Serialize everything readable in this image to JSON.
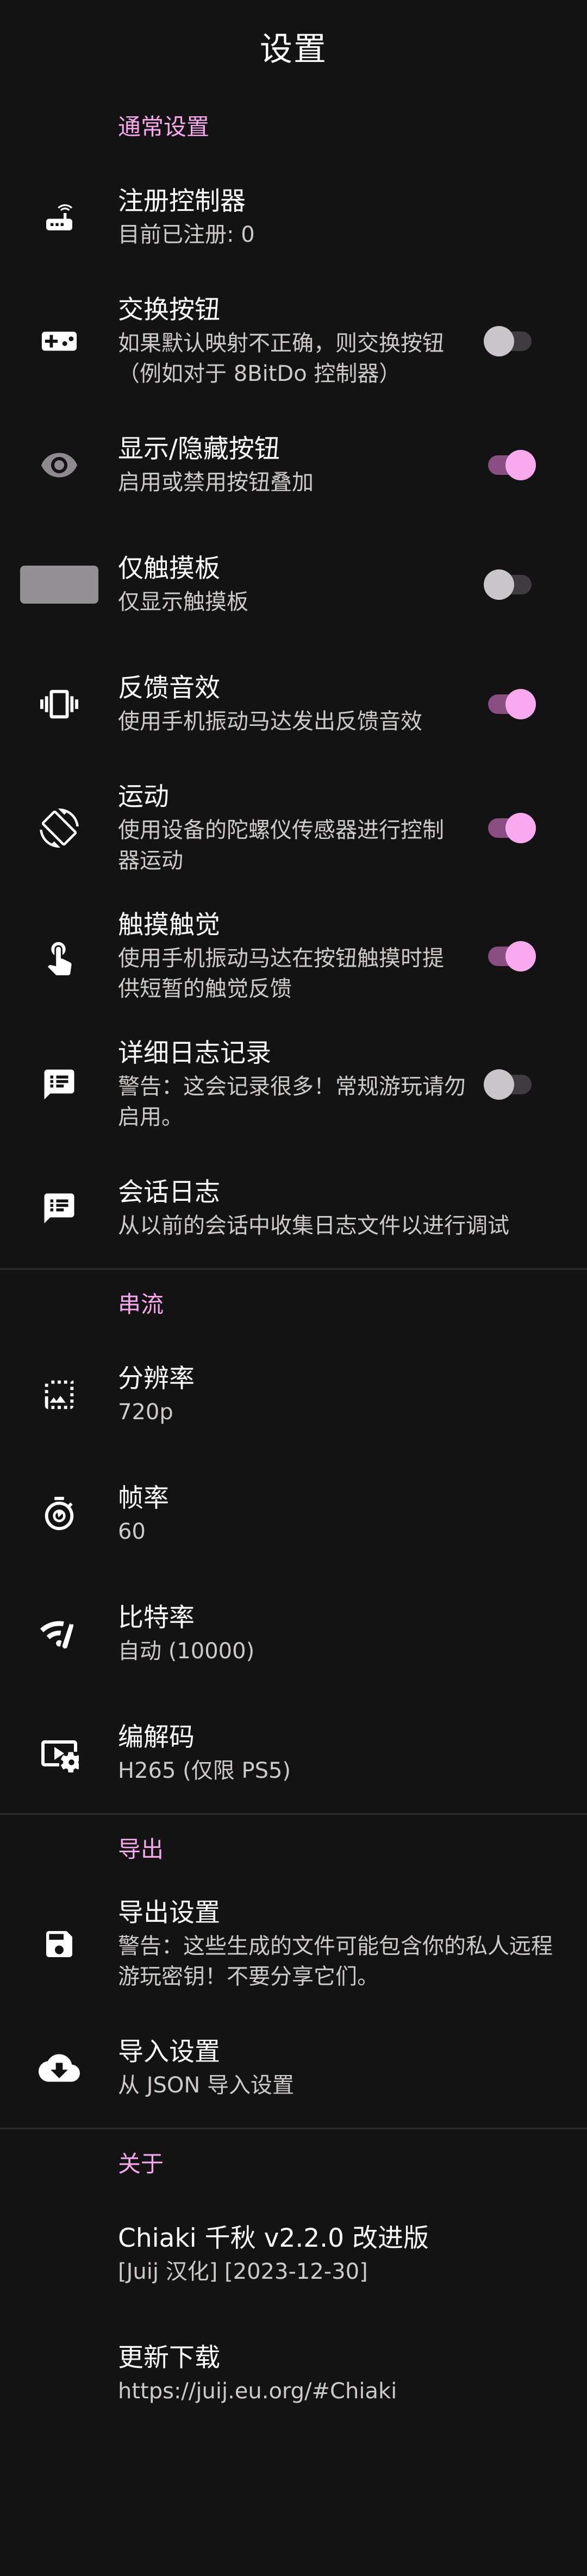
{
  "app": {
    "title": "设置"
  },
  "sections": [
    {
      "title": "通常设置",
      "items": [
        {
          "label": "注册控制器",
          "desc": "目前已注册: 0",
          "icon": "router-icon"
        },
        {
          "label": "交换按钮",
          "desc": "如果默认映射不正确，则交换按钮（例如对于 8BitDo 控制器）",
          "icon": "gamepad-icon",
          "toggle": false
        },
        {
          "label": "显示/隐藏按钮",
          "desc": "启用或禁用按钮叠加",
          "icon": "eye-icon",
          "toggle": true
        },
        {
          "label": "仅触摸板",
          "desc": "仅显示触摸板",
          "icon": "touchpad-icon",
          "toggle": false
        },
        {
          "label": "反馈音效",
          "desc": "使用手机振动马达发出反馈音效",
          "icon": "vibration-icon",
          "toggle": true
        },
        {
          "label": "运动",
          "desc": "使用设备的陀螺仪传感器进行控制器运动",
          "icon": "screen-rotation-icon",
          "toggle": true
        },
        {
          "label": "触摸触觉",
          "desc": "使用手机振动马达在按钮触摸时提供短暂的触觉反馈",
          "icon": "touch-icon",
          "toggle": true
        },
        {
          "label": "详细日志记录",
          "desc": "警告：这会记录很多！常规游玩请勿启用。",
          "icon": "log-icon",
          "toggle": false
        },
        {
          "label": "会话日志",
          "desc": "从以前的会话中收集日志文件以进行调试",
          "icon": "log-icon"
        }
      ]
    },
    {
      "title": "串流",
      "items": [
        {
          "label": "分辨率",
          "desc": "720p",
          "icon": "resolution-icon"
        },
        {
          "label": "帧率",
          "desc": "60",
          "icon": "timer-icon"
        },
        {
          "label": "比特率",
          "desc": "自动 (10000)",
          "icon": "signal-icon"
        },
        {
          "label": "编解码",
          "desc": "H265 (仅限 PS5)",
          "icon": "video-settings-icon"
        }
      ]
    },
    {
      "title": "导出",
      "items": [
        {
          "label": "导出设置",
          "desc": "警告：这些生成的文件可能包含你的私人远程游玩密钥！不要分享它们。",
          "icon": "save-icon"
        },
        {
          "label": "导入设置",
          "desc": "从 JSON 导入设置",
          "icon": "cloud-download-icon"
        }
      ]
    },
    {
      "title": "关于",
      "items": [
        {
          "label": "Chiaki 千秋 v2.2.0 改进版",
          "desc": "[Juij 汉化] [2023-12-30]"
        },
        {
          "label": "更新下载",
          "desc": "https://juij.eu.org/#Chiaki"
        }
      ]
    }
  ],
  "colors": {
    "background": "#141314",
    "accent": "#f7a8ec",
    "toggle_on": "#f9a9ed",
    "toggle_off": "#c9c5c8"
  }
}
